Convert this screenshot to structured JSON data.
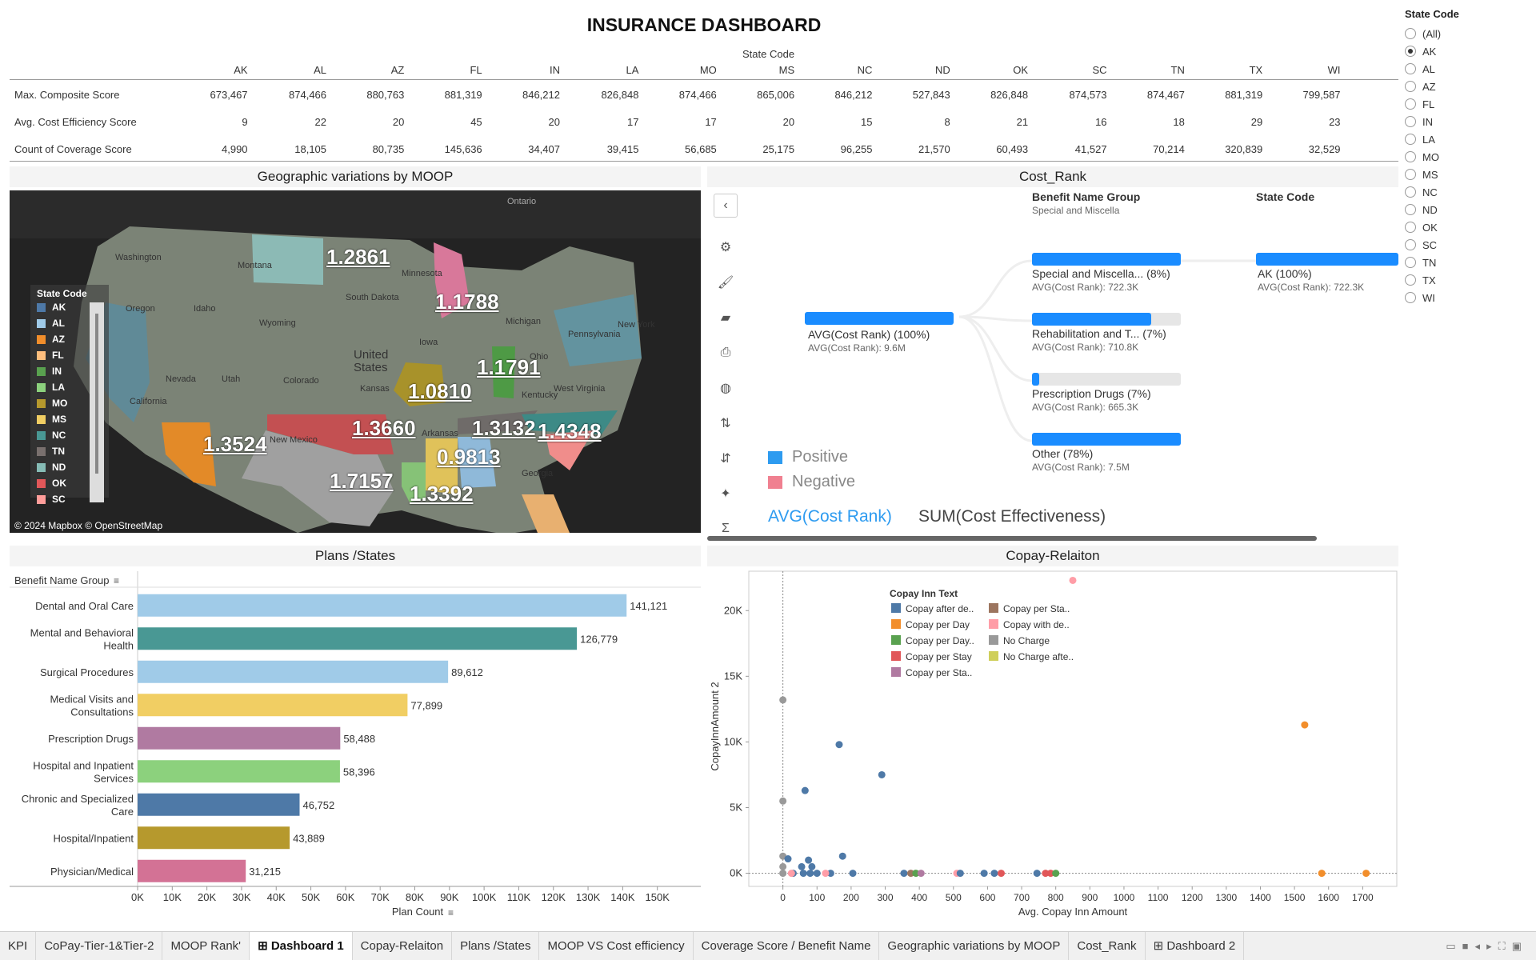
{
  "title": "INSURANCE DASHBOARD",
  "table": {
    "header": "State Code",
    "columns": [
      "AK",
      "AL",
      "AZ",
      "FL",
      "IN",
      "LA",
      "MO",
      "MS",
      "NC",
      "ND",
      "OK",
      "SC",
      "TN",
      "TX",
      "WI"
    ],
    "rows": [
      {
        "label": "Max. Composite Score",
        "values": [
          "673,467",
          "874,466",
          "880,763",
          "881,319",
          "846,212",
          "826,848",
          "874,466",
          "865,006",
          "846,212",
          "527,843",
          "826,848",
          "874,573",
          "874,467",
          "881,319",
          "799,587"
        ]
      },
      {
        "label": "Avg. Cost Efficiency Score",
        "values": [
          "9",
          "22",
          "20",
          "45",
          "20",
          "17",
          "17",
          "20",
          "15",
          "8",
          "21",
          "16",
          "18",
          "29",
          "23"
        ]
      },
      {
        "label": "Count of Coverage Score",
        "values": [
          "4,990",
          "18,105",
          "80,735",
          "145,636",
          "34,407",
          "39,415",
          "56,685",
          "25,175",
          "96,255",
          "21,570",
          "60,493",
          "41,527",
          "70,214",
          "320,839",
          "32,529"
        ]
      }
    ]
  },
  "filter": {
    "title": "State Code",
    "options": [
      "(All)",
      "AK",
      "AL",
      "AZ",
      "FL",
      "IN",
      "LA",
      "MO",
      "MS",
      "NC",
      "ND",
      "OK",
      "SC",
      "TN",
      "TX",
      "WI"
    ],
    "selected": "AK"
  },
  "map": {
    "title": "Geographic variations by MOOP",
    "legend_title": "State Code",
    "legend": [
      {
        "code": "AK",
        "color": "#4e79a7"
      },
      {
        "code": "AL",
        "color": "#a0cbe8"
      },
      {
        "code": "AZ",
        "color": "#f28e2b"
      },
      {
        "code": "FL",
        "color": "#ffbe7d"
      },
      {
        "code": "IN",
        "color": "#59a14f"
      },
      {
        "code": "LA",
        "color": "#8cd17d"
      },
      {
        "code": "MO",
        "color": "#b6992d"
      },
      {
        "code": "MS",
        "color": "#f1ce63"
      },
      {
        "code": "NC",
        "color": "#499894"
      },
      {
        "code": "TN",
        "color": "#79706e"
      },
      {
        "code": "ND",
        "color": "#86bcb6"
      },
      {
        "code": "OK",
        "color": "#e15759"
      },
      {
        "code": "SC",
        "color": "#ff9d9a"
      }
    ],
    "credit": "© 2024 Mapbox © OpenStreetMap",
    "place_names": [
      "Ontario",
      "Washington",
      "Montana",
      "Oregon",
      "Idaho",
      "Wyoming",
      "South Dakota",
      "Minnesota",
      "Iowa",
      "Michigan",
      "Nevada",
      "Utah",
      "Colorado",
      "Kansas",
      "California",
      "New Mexico",
      "Arkansas",
      "Ohio",
      "Pennsylvania",
      "New York",
      "West Virginia",
      "Kentucky",
      "Georgia",
      "United States"
    ],
    "values": [
      "1.2861",
      "1.1788",
      "1.1791",
      "1.0810",
      "1.3660",
      "1.3524",
      "1.3132",
      "1.4348",
      "0.9813",
      "1.7157",
      "1.3392"
    ]
  },
  "cost_rank": {
    "title": "Cost_Rank",
    "col1_header": "Benefit Name Group",
    "col1_sub": "Special and Miscella",
    "col2_header": "State Code",
    "root": {
      "label": "AVG(Cost Rank) (100%)",
      "sub": "AVG(Cost Rank): 9.6M",
      "fill": 1.0
    },
    "children": [
      {
        "label": "Special and Miscella... (8%)",
        "sub": "AVG(Cost Rank): 722.3K",
        "fill": 1.0
      },
      {
        "label": "Rehabilitation and T... (7%)",
        "sub": "AVG(Cost Rank): 710.8K",
        "fill": 0.8
      },
      {
        "label": "Prescription Drugs (7%)",
        "sub": "AVG(Cost Rank): 665.3K",
        "fill": 0.05
      },
      {
        "label": "Other (78%)",
        "sub": "AVG(Cost Rank): 7.5M",
        "fill": 1.0
      }
    ],
    "leaf": {
      "label": "AK (100%)",
      "sub": "AVG(Cost Rank): 722.3K",
      "fill": 1.0
    },
    "legend": [
      {
        "label": "Positive",
        "color": "#2d9bf0"
      },
      {
        "label": "Negative",
        "color": "#f08090"
      }
    ],
    "measures": [
      "AVG(Cost Rank)",
      "SUM(Cost Effectiveness)"
    ],
    "tools": [
      "chevron-left",
      "gear",
      "paint",
      "tag",
      "print",
      "globe",
      "sort",
      "filter",
      "bulb",
      "sigma"
    ]
  },
  "plans": {
    "title": "Plans /States",
    "row_header": "Benefit Name Group",
    "xlabel": "Plan Count",
    "chart_data": {
      "type": "bar",
      "categories": [
        "Dental and Oral Care",
        "Mental and Behavioral Health",
        "Surgical Procedures",
        "Medical Visits and Consultations",
        "Prescription Drugs",
        "Hospital and Inpatient Services",
        "Chronic and Specialized Care",
        "Hospital/Inpatient",
        "Physician/Medical"
      ],
      "values": [
        141121,
        126779,
        89612,
        77899,
        58488,
        58396,
        46752,
        43889,
        31215
      ],
      "labels": [
        "141,121",
        "126,779",
        "89,612",
        "77,899",
        "58,488",
        "58,396",
        "46,752",
        "43,889",
        "31,215"
      ],
      "colors": [
        "#a0cbe8",
        "#499894",
        "#a0cbe8",
        "#f1ce63",
        "#b07aa1",
        "#8cd17d",
        "#4e79a7",
        "#b6992d",
        "#d37295"
      ],
      "xlim": [
        0,
        160000
      ],
      "xticks": [
        "0K",
        "10K",
        "20K",
        "30K",
        "40K",
        "50K",
        "60K",
        "70K",
        "80K",
        "90K",
        "100K",
        "110K",
        "120K",
        "130K",
        "140K",
        "150K"
      ]
    }
  },
  "copay": {
    "title": "Copay-Relaiton",
    "legend_title": "Copay Inn Text",
    "legend": [
      {
        "label": "Copay after de..",
        "color": "#4e79a7"
      },
      {
        "label": "Copay per Day",
        "color": "#f28e2b"
      },
      {
        "label": "Copay per Day..",
        "color": "#59a14f"
      },
      {
        "label": "Copay per Stay",
        "color": "#e15759"
      },
      {
        "label": "Copay per Sta..",
        "color": "#b07aa1"
      },
      {
        "label": "Copay per Sta..",
        "color": "#9c755f"
      },
      {
        "label": "Copay with de..",
        "color": "#ff9da7"
      },
      {
        "label": "No Charge",
        "color": "#999999"
      },
      {
        "label": "No Charge afte..",
        "color": "#cfcf5b"
      }
    ],
    "chart_data": {
      "type": "scatter",
      "xlabel": "Avg. Copay Inn Amount",
      "ylabel": "CopayInnAmount 2",
      "xlim": [
        -100,
        1800
      ],
      "ylim": [
        -1000,
        23000
      ],
      "xticks": [
        "0",
        "100",
        "200",
        "300",
        "400",
        "500",
        "600",
        "700",
        "800",
        "900",
        "1000",
        "1100",
        "1200",
        "1300",
        "1400",
        "1500",
        "1600",
        "1700"
      ],
      "yticks": [
        "0K",
        "5K",
        "10K",
        "15K",
        "20K"
      ],
      "points": [
        {
          "x": 850,
          "y": 22300,
          "s": 6
        },
        {
          "x": 1530,
          "y": 11300,
          "s": 1
        },
        {
          "x": 0,
          "y": 13200,
          "s": 7
        },
        {
          "x": 165,
          "y": 9800,
          "s": 0
        },
        {
          "x": 65,
          "y": 6300,
          "s": 0
        },
        {
          "x": 290,
          "y": 7500,
          "s": 0
        },
        {
          "x": 0,
          "y": 5500,
          "s": 7
        },
        {
          "x": 175,
          "y": 1300,
          "s": 0
        },
        {
          "x": 0,
          "y": 1300,
          "s": 7
        },
        {
          "x": 15,
          "y": 1100,
          "s": 0
        },
        {
          "x": 75,
          "y": 1000,
          "s": 0
        },
        {
          "x": 55,
          "y": 500,
          "s": 0
        },
        {
          "x": 85,
          "y": 500,
          "s": 0
        },
        {
          "x": 0,
          "y": 500,
          "s": 7
        },
        {
          "x": 0,
          "y": 0,
          "s": 7
        },
        {
          "x": 30,
          "y": 0,
          "s": 0
        },
        {
          "x": 60,
          "y": 0,
          "s": 0
        },
        {
          "x": 80,
          "y": 0,
          "s": 0
        },
        {
          "x": 100,
          "y": 0,
          "s": 0
        },
        {
          "x": 140,
          "y": 0,
          "s": 0
        },
        {
          "x": 205,
          "y": 0,
          "s": 0
        },
        {
          "x": 355,
          "y": 0,
          "s": 0
        },
        {
          "x": 375,
          "y": 0,
          "s": 5
        },
        {
          "x": 390,
          "y": 0,
          "s": 2
        },
        {
          "x": 405,
          "y": 0,
          "s": 4
        },
        {
          "x": 510,
          "y": 0,
          "s": 6
        },
        {
          "x": 520,
          "y": 0,
          "s": 0
        },
        {
          "x": 590,
          "y": 0,
          "s": 0
        },
        {
          "x": 620,
          "y": 0,
          "s": 0
        },
        {
          "x": 640,
          "y": 0,
          "s": 3
        },
        {
          "x": 745,
          "y": 0,
          "s": 0
        },
        {
          "x": 770,
          "y": 0,
          "s": 3
        },
        {
          "x": 785,
          "y": 0,
          "s": 3
        },
        {
          "x": 800,
          "y": 0,
          "s": 2
        },
        {
          "x": 25,
          "y": 0,
          "s": 6
        },
        {
          "x": 125,
          "y": 0,
          "s": 6
        },
        {
          "x": 1580,
          "y": 0,
          "s": 1
        },
        {
          "x": 1710,
          "y": 0,
          "s": 1
        }
      ]
    }
  },
  "tabs": [
    {
      "label": "KPI",
      "icon": false,
      "active": false
    },
    {
      "label": "CoPay-Tier-1&Tier-2",
      "icon": false,
      "active": false
    },
    {
      "label": "MOOP Rank'",
      "icon": false,
      "active": false
    },
    {
      "label": "Dashboard 1",
      "icon": true,
      "active": true
    },
    {
      "label": "Copay-Relaiton",
      "icon": false,
      "active": false
    },
    {
      "label": "Plans /States",
      "icon": false,
      "active": false
    },
    {
      "label": "MOOP VS Cost efficiency",
      "icon": false,
      "active": false
    },
    {
      "label": "Coverage Score / Benefit Name",
      "icon": false,
      "active": false
    },
    {
      "label": "Geographic variations by MOOP",
      "icon": false,
      "active": false
    },
    {
      "label": "Cost_Rank",
      "icon": false,
      "active": false
    },
    {
      "label": "Dashboard 2",
      "icon": true,
      "active": false
    }
  ]
}
